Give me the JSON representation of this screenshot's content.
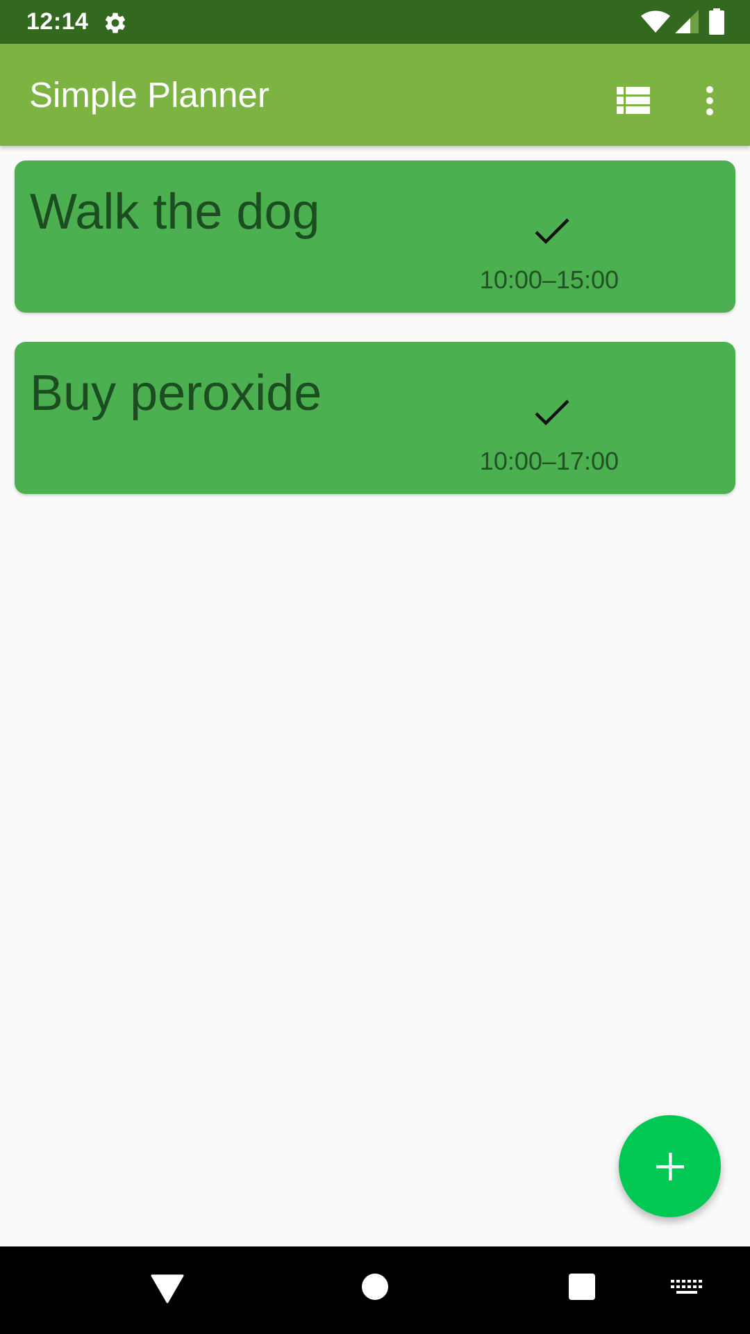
{
  "status_bar": {
    "time": "12:14",
    "icons": [
      "gear-icon",
      "wifi-icon",
      "signal-icon",
      "battery-icon"
    ]
  },
  "app_bar": {
    "title": "Simple Planner",
    "actions": [
      "list-view-icon",
      "more-vert-icon"
    ]
  },
  "tasks": [
    {
      "title": "Walk the dog",
      "time_range": "10:00–15:00",
      "done_icon": "check-icon"
    },
    {
      "title": "Buy peroxide",
      "time_range": "10:00–17:00",
      "done_icon": "check-icon"
    }
  ],
  "fab": {
    "icon": "plus-icon"
  },
  "nav_bar": {
    "buttons": [
      "back-icon",
      "home-icon",
      "recents-icon",
      "keyboard-icon"
    ]
  },
  "colors": {
    "status_bar": "#33691e",
    "app_bar": "#7cb342",
    "card": "#4caf50",
    "card_text": "#1b4d20",
    "fab": "#00c853",
    "background": "#fafafa",
    "nav_bar": "#000000"
  }
}
